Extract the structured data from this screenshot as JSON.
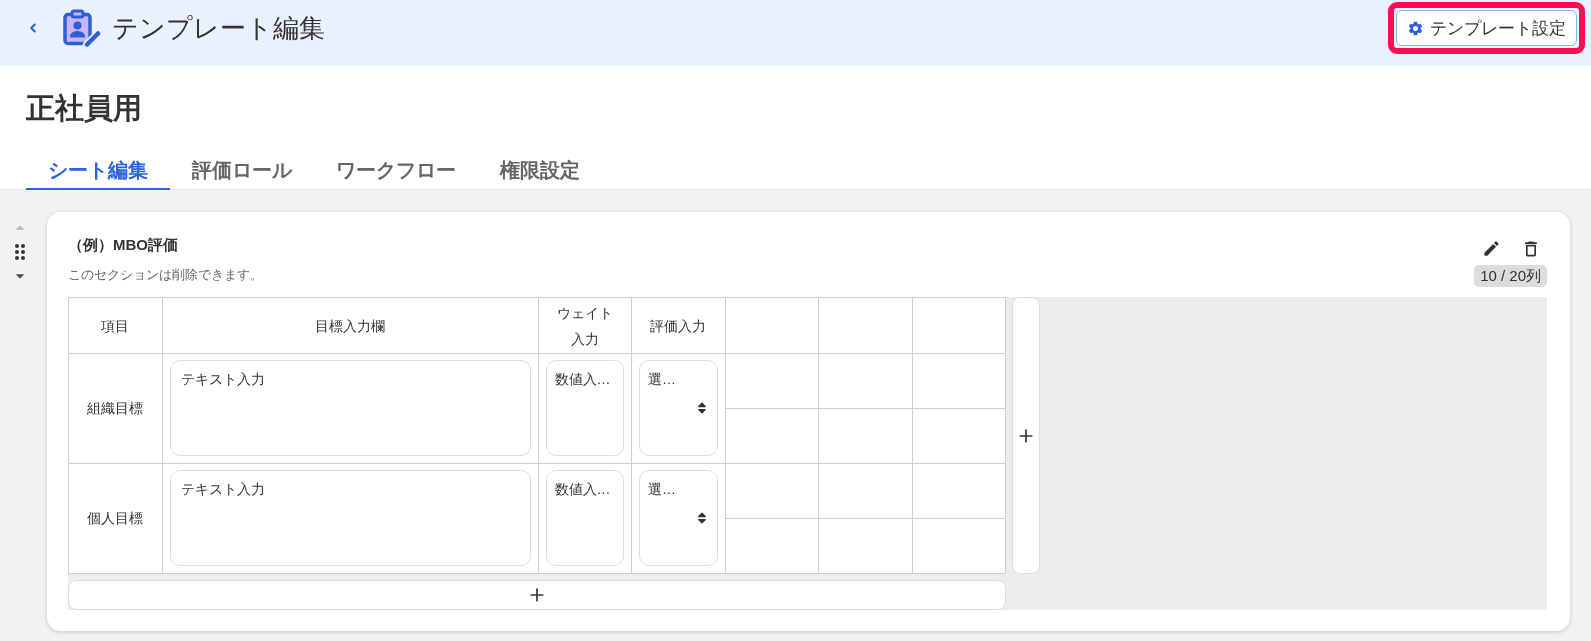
{
  "header": {
    "title": "テンプレート編集",
    "settings_button": {
      "label": "テンプレート設定",
      "highlighted": true
    }
  },
  "page_title": "正社員用",
  "tabs": [
    {
      "label": "シート編集",
      "selected": true
    },
    {
      "label": "評価ロール",
      "selected": false
    },
    {
      "label": "ワークフロー",
      "selected": false
    },
    {
      "label": "権限設定",
      "selected": false
    }
  ],
  "section": {
    "move_up_disabled": true,
    "move_down_disabled": false,
    "title": "（例）MBO評価",
    "note": "このセクションは削除できます。",
    "column_count": "10 / 20列",
    "table": {
      "columns": [
        {
          "kind": "label",
          "label": "項目"
        },
        {
          "kind": "label",
          "label": "目標入力欄"
        },
        {
          "kind": "label",
          "label": "ウェイト入力"
        },
        {
          "kind": "label",
          "label": "評価入力"
        },
        {
          "kind": "blank"
        },
        {
          "kind": "blank"
        },
        {
          "kind": "blank"
        }
      ],
      "rows": [
        {
          "cells": [
            {
              "kind": "label",
              "text": "組織目標"
            },
            {
              "kind": "text",
              "placeholder": "テキスト入力"
            },
            {
              "kind": "number",
              "placeholder": "数値入…"
            },
            {
              "kind": "select",
              "placeholder": "選…"
            },
            {
              "kind": "split"
            },
            {
              "kind": "split"
            },
            {
              "kind": "split"
            }
          ]
        },
        {
          "cells": [
            {
              "kind": "label",
              "text": "個人目標"
            },
            {
              "kind": "text",
              "placeholder": "テキスト入力"
            },
            {
              "kind": "number",
              "placeholder": "数値入…"
            },
            {
              "kind": "select",
              "placeholder": "選…"
            },
            {
              "kind": "split"
            },
            {
              "kind": "split"
            },
            {
              "kind": "split"
            }
          ]
        }
      ]
    }
  }
}
